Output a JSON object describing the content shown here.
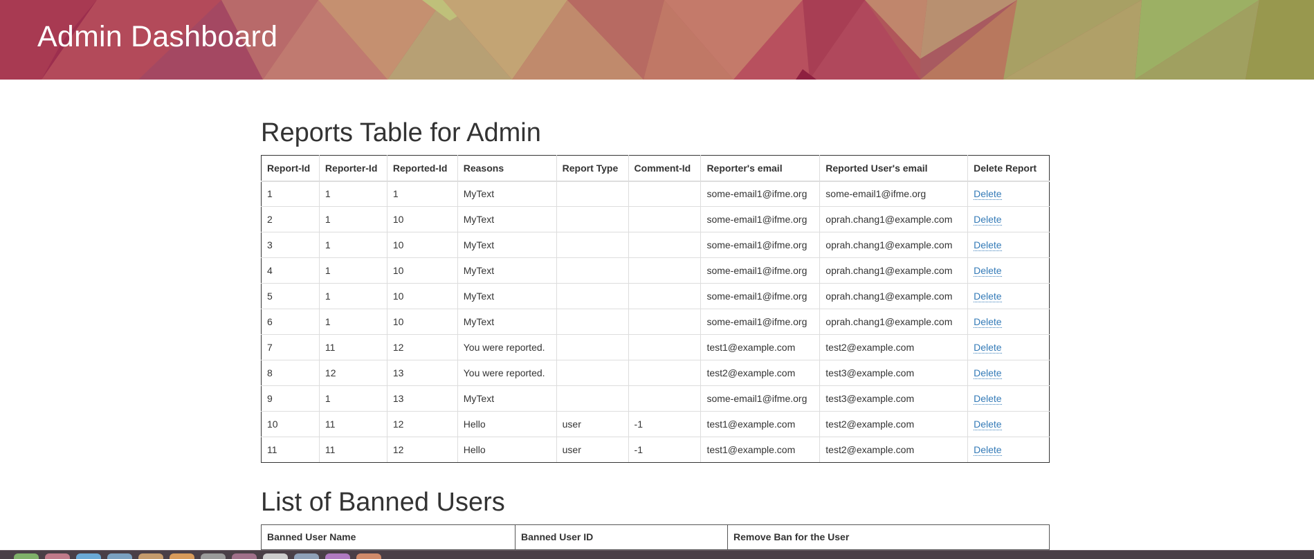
{
  "header": {
    "title": "Admin Dashboard"
  },
  "reports": {
    "title": "Reports Table for Admin",
    "columns": [
      "Report-Id",
      "Reporter-Id",
      "Reported-Id",
      "Reasons",
      "Report Type",
      "Comment-Id",
      "Reporter's email",
      "Reported User's email",
      "Delete Report"
    ],
    "rows": [
      {
        "report_id": "1",
        "reporter_id": "1",
        "reported_id": "1",
        "reasons": "MyText",
        "report_type": "",
        "comment_id": "",
        "reporter_email": "some-email1@ifme.org",
        "reported_email": "some-email1@ifme.org",
        "delete_label": "Delete"
      },
      {
        "report_id": "2",
        "reporter_id": "1",
        "reported_id": "10",
        "reasons": "MyText",
        "report_type": "",
        "comment_id": "",
        "reporter_email": "some-email1@ifme.org",
        "reported_email": "oprah.chang1@example.com",
        "delete_label": "Delete"
      },
      {
        "report_id": "3",
        "reporter_id": "1",
        "reported_id": "10",
        "reasons": "MyText",
        "report_type": "",
        "comment_id": "",
        "reporter_email": "some-email1@ifme.org",
        "reported_email": "oprah.chang1@example.com",
        "delete_label": "Delete"
      },
      {
        "report_id": "4",
        "reporter_id": "1",
        "reported_id": "10",
        "reasons": "MyText",
        "report_type": "",
        "comment_id": "",
        "reporter_email": "some-email1@ifme.org",
        "reported_email": "oprah.chang1@example.com",
        "delete_label": "Delete"
      },
      {
        "report_id": "5",
        "reporter_id": "1",
        "reported_id": "10",
        "reasons": "MyText",
        "report_type": "",
        "comment_id": "",
        "reporter_email": "some-email1@ifme.org",
        "reported_email": "oprah.chang1@example.com",
        "delete_label": "Delete"
      },
      {
        "report_id": "6",
        "reporter_id": "1",
        "reported_id": "10",
        "reasons": "MyText",
        "report_type": "",
        "comment_id": "",
        "reporter_email": "some-email1@ifme.org",
        "reported_email": "oprah.chang1@example.com",
        "delete_label": "Delete"
      },
      {
        "report_id": "7",
        "reporter_id": "11",
        "reported_id": "12",
        "reasons": "You were reported.",
        "report_type": "",
        "comment_id": "",
        "reporter_email": "test1@example.com",
        "reported_email": "test2@example.com",
        "delete_label": "Delete"
      },
      {
        "report_id": "8",
        "reporter_id": "12",
        "reported_id": "13",
        "reasons": "You were reported.",
        "report_type": "",
        "comment_id": "",
        "reporter_email": "test2@example.com",
        "reported_email": "test3@example.com",
        "delete_label": "Delete"
      },
      {
        "report_id": "9",
        "reporter_id": "1",
        "reported_id": "13",
        "reasons": "MyText",
        "report_type": "",
        "comment_id": "",
        "reporter_email": "some-email1@ifme.org",
        "reported_email": "test3@example.com",
        "delete_label": "Delete"
      },
      {
        "report_id": "10",
        "reporter_id": "11",
        "reported_id": "12",
        "reasons": "Hello",
        "report_type": "user",
        "comment_id": "-1",
        "reporter_email": "test1@example.com",
        "reported_email": "test2@example.com",
        "delete_label": "Delete"
      },
      {
        "report_id": "11",
        "reporter_id": "11",
        "reported_id": "12",
        "reasons": "Hello",
        "report_type": "user",
        "comment_id": "-1",
        "reporter_email": "test1@example.com",
        "reported_email": "test2@example.com",
        "delete_label": "Delete"
      }
    ]
  },
  "banned": {
    "title": "List of Banned Users",
    "columns": [
      "Banned User Name",
      "Banned User ID",
      "Remove Ban for the User"
    ]
  },
  "colors": {
    "link": "#337ab7",
    "text": "#333333",
    "banner_base": "#b0565a",
    "taskbar": "#4a3f47"
  },
  "taskbar": {
    "icons": [
      "app-icon",
      "app-icon",
      "app-icon",
      "app-icon",
      "app-icon",
      "app-icon",
      "app-icon",
      "app-icon",
      "app-icon",
      "app-icon",
      "app-icon",
      "app-icon"
    ],
    "icon_colors": [
      "#7fb069",
      "#c07a8a",
      "#6aa9d6",
      "#7aa0c0",
      "#c49a6c",
      "#d89a5a",
      "#9a9a9a",
      "#a0708a",
      "#cccccc",
      "#8fa0b8",
      "#b07ac0",
      "#d08a6a"
    ]
  }
}
